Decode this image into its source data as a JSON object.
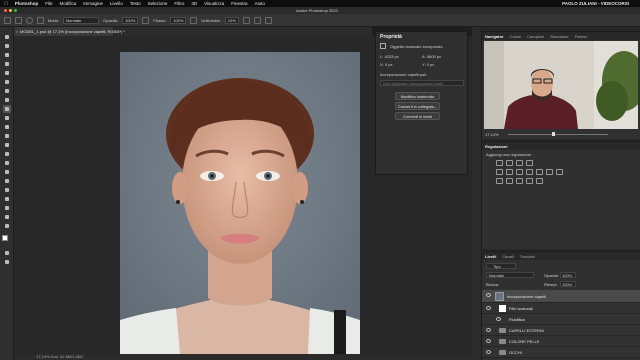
{
  "menubar": {
    "app_name": "Photoshop",
    "items": [
      "File",
      "Modifica",
      "Immagine",
      "Livello",
      "Testo",
      "Selezione",
      "Filtro",
      "3D",
      "Visualizza",
      "Finestra",
      "Aiuto"
    ],
    "window_title": "Adobe Photoshop 2020",
    "user": "PAOLO ZULIANI - VIDEOCORSI"
  },
  "options_bar": {
    "mode_label": "Modo:",
    "mode_value": "Normale",
    "opacity_label": "Opacità:",
    "opacity_value": "100%",
    "flow_label": "Flusso:",
    "flow_value": "100%",
    "smoothing_label": "Uniformità:",
    "smoothing_value": "10%"
  },
  "document": {
    "tab_title": "MODEL_1.psd @ 17,1% (Incorporazione capelli, RGB/8*) *",
    "status": "17,14%   Doc: 62,8M/1,06G"
  },
  "properties_panel": {
    "title": "Proprietà",
    "object_type": "Oggetto avanzato incorporato",
    "width": "L: 4233 px",
    "height": "A: 5600 px",
    "x": "X: 0 px",
    "y": "Y: 0 px",
    "file_name": "Incorporazione capelli.psb",
    "comp_placeholder": "Non applicare composizione livelli",
    "buttons": [
      "Modifica contenuto",
      "Converti in collegato...",
      "Converti in livelli"
    ]
  },
  "navigator_panel": {
    "tabs": [
      "Navigator",
      "Colore",
      "Campioni",
      "Sfumature",
      "Pattern"
    ],
    "zoom": "17,14%"
  },
  "adjustments_panel": {
    "title": "Regolazioni",
    "subtitle": "Aggiungi una regolazione"
  },
  "layers_panel": {
    "tabs": [
      "Livelli",
      "Canali",
      "Tracciati"
    ],
    "filter_label": "Tipo",
    "blend_mode": "Normale",
    "opacity_label": "Opacità:",
    "opacity_value": "100%",
    "lock_label": "Blocca:",
    "fill_label": "Riempi:",
    "fill_value": "100%",
    "layers": [
      {
        "name": "Incorporazione capelli",
        "selected": true,
        "type": "smart"
      },
      {
        "name": "Filtri avanzati",
        "selected": false,
        "type": "filter"
      },
      {
        "name": "Fluidifica",
        "selected": false,
        "type": "effect"
      },
      {
        "name": "CAPELLI ESTERNI",
        "selected": false,
        "type": "group"
      },
      {
        "name": "COLORE PELLE",
        "selected": false,
        "type": "group"
      },
      {
        "name": "OCCHI",
        "selected": false,
        "type": "group"
      }
    ]
  },
  "colors": {
    "panel_bg": "#303030",
    "canvas_bg": "#282828",
    "photo_bg": "#6a7580",
    "foreground": "#ffffff",
    "background": "#000000"
  }
}
